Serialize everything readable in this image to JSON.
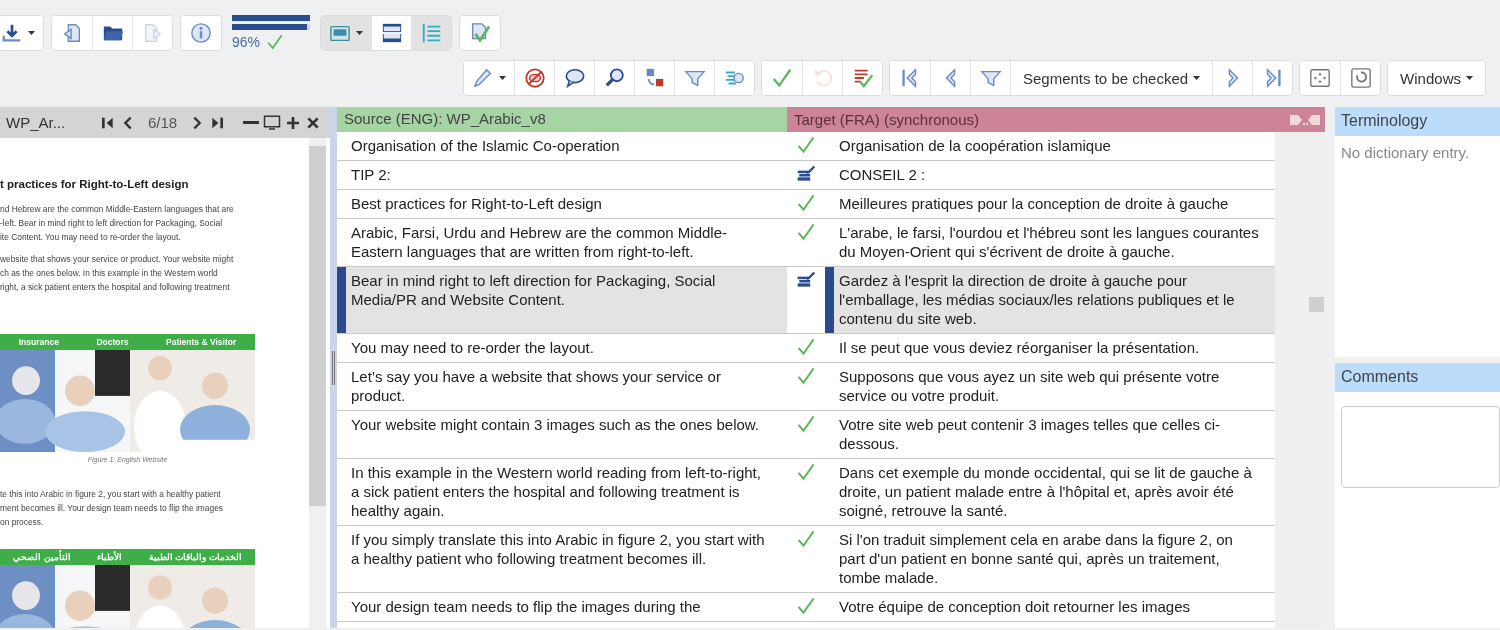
{
  "toolbar_top": {
    "items": [
      {
        "kind": "group",
        "buttons": [
          {
            "kind": "icon"
          }
        ]
      },
      {
        "kind": "group",
        "buttons": [
          {
            "kind": "icon",
            "disabled": false
          },
          {
            "kind": "icon",
            "disabled": false
          },
          {
            "kind": "icon",
            "disabled": true
          }
        ]
      },
      {
        "kind": "group",
        "buttons": [
          {
            "kind": "icon"
          }
        ]
      },
      {
        "kind": "progress",
        "bars": [
          {
            "level": 1
          },
          {
            "level": 0.96
          }
        ],
        "label": "96%"
      },
      {
        "kind": "group",
        "buttons": [
          {
            "kind": "icon",
            "selected": true
          },
          {
            "kind": "icon",
            "selected": false
          },
          {
            "kind": "icon",
            "selected": true
          }
        ]
      },
      {
        "kind": "group",
        "buttons": [
          {
            "kind": "icon"
          }
        ]
      }
    ]
  },
  "toolbar_bottom": {
    "items": [
      {
        "kind": "group",
        "buttons": [
          {
            "kind": "icon"
          },
          {
            "kind": "icon"
          },
          {
            "kind": "icon"
          },
          {
            "kind": "icon"
          },
          {
            "kind": "icon"
          },
          {
            "kind": "icon"
          },
          {
            "kind": "icon"
          }
        ]
      },
      {
        "kind": "group",
        "buttons": [
          {
            "kind": "icon",
            "disabled": false
          },
          {
            "kind": "icon",
            "disabled": true
          },
          {
            "kind": "icon",
            "disabled": false
          }
        ]
      },
      {
        "kind": "group",
        "buttons": [
          {
            "kind": "icon"
          },
          {
            "kind": "icon"
          },
          {
            "kind": "icon"
          },
          {
            "kind": "dropdown",
            "label": "Segments to be checked"
          },
          {
            "kind": "icon"
          },
          {
            "kind": "icon"
          }
        ]
      },
      {
        "kind": "group",
        "buttons": [
          {
            "kind": "icon"
          },
          {
            "kind": "icon"
          }
        ]
      },
      {
        "kind": "group",
        "buttons": [
          {
            "kind": "dropdown",
            "label": "Windows"
          }
        ]
      }
    ]
  },
  "preview": {
    "title": "WP_Ar...",
    "page": "6/18",
    "heading": "t practices for Right-to-Left design",
    "paragraph_1": [
      "nd Hebrew are the common Middle-Eastern languages that are",
      "-left. Bear in mind right to left direction for Packaging, Social",
      "ite Content. You may need to re-order the layout."
    ],
    "paragraph_2": [
      "website that shows your service or product. Your website might",
      "ch as the ones below. In this example in the Western world",
      "right, a sick patient enters the hospital and following treatment"
    ],
    "figure_1": {
      "labels": [
        "Insurance",
        "Doctors",
        "Patients & Visitor"
      ],
      "caption": "Figure 1: English Website"
    },
    "paragraph_3": [
      "te this into Arabic in figure 2, you start with a healthy patient",
      "ment becomes ill. Your design team needs to flip the images",
      "on process."
    ],
    "figure_2": {
      "labels": [
        "الخدمات والباقات الطبية",
        "الأطباء",
        "التأمين الصحي"
      ]
    }
  },
  "editor": {
    "source_header": "Source (ENG): WP_Arabic_v8",
    "target_header": "Target (FRA) (synchronous)",
    "segments": [
      {
        "source": "Organisation of the Islamic Co-operation",
        "target": "Organisation de la coopération islamique",
        "kind": "confirmed",
        "selected": false
      },
      {
        "source": "TIP 2:",
        "target": "CONSEIL 2 :",
        "kind": "edited",
        "selected": false
      },
      {
        "source": "Best practices for Right-to-Left design",
        "target": "Meilleures pratiques pour la conception de droite à gauche",
        "kind": "confirmed",
        "selected": false
      },
      {
        "source": "Arabic, Farsi, Urdu and Hebrew are the common Middle-Eastern languages that are written from right-to-left.",
        "target": "L'arabe, le farsi, l'ourdou et l'hébreu sont les langues courantes du Moyen-Orient qui s'écrivent de droite à gauche.",
        "kind": "confirmed",
        "selected": false
      },
      {
        "source": "Bear in mind right to left direction for Packaging, Social Media/PR and Website Content.",
        "target": "Gardez à l'esprit la direction de droite à gauche pour l'emballage, les médias sociaux/les relations publiques et le contenu du site web.",
        "kind": "edited",
        "selected": true
      },
      {
        "source": "You may need to re-order the layout.",
        "target": "Il se peut que vous deviez réorganiser la présentation.",
        "kind": "confirmed",
        "selected": false
      },
      {
        "source": "Let’s say you have a website that shows your service or product.",
        "target": "Supposons que vous ayez un site web qui présente votre service ou votre produit.",
        "kind": "confirmed",
        "selected": false
      },
      {
        "source": "Your website might contain 3 images such as the ones below.",
        "target": "Votre site web peut contenir 3 images telles que celles ci-dessous.",
        "kind": "confirmed",
        "selected": false
      },
      {
        "source": "In this example in the Western world reading from left-to-right, a sick patient enters the hospital and following treatment is healthy again.",
        "target": "Dans cet exemple du monde occidental, qui se lit de gauche à droite, un patient malade entre à l'hôpital et, après avoir été soigné, retrouve la santé.",
        "kind": "confirmed",
        "selected": false
      },
      {
        "source": "If you simply translate this into Arabic in figure 2, you start with a healthy patient who following treatment becomes ill.",
        "target": "Si l'on traduit simplement cela en arabe dans la figure 2, on part d'un patient en bonne santé qui, après un traitement, tombe malade.",
        "kind": "confirmed",
        "selected": false
      },
      {
        "source": "Your design team needs to flip the images during the",
        "target": "Votre équipe de conception doit retourner les images",
        "kind": "confirmed",
        "selected": false
      }
    ]
  },
  "terminology": {
    "title": "Terminology",
    "message": "No dictionary entry."
  },
  "comments": {
    "title": "Comments"
  }
}
